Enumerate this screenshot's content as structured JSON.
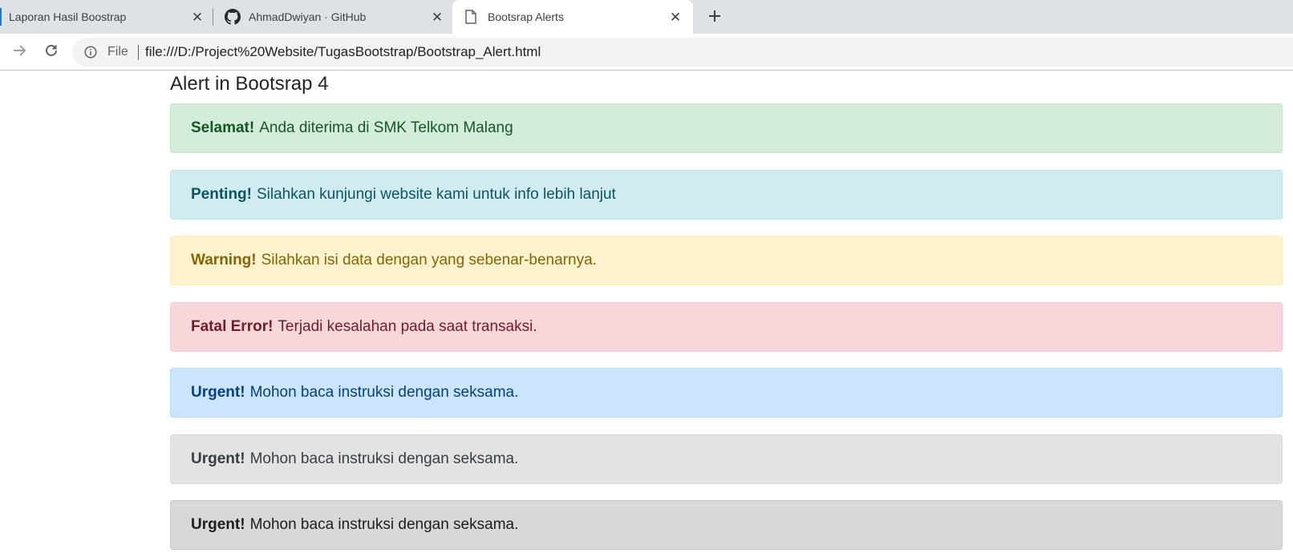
{
  "tabs": [
    {
      "label": "Laporan Hasil Boostrap",
      "icon": "tab-edge-icon"
    },
    {
      "label": "AhmadDwiyan · GitHub",
      "icon": "github-icon"
    },
    {
      "label": "Bootsrap Alerts",
      "icon": "document-icon",
      "active": true
    }
  ],
  "toolbar": {
    "scheme_label": "File",
    "url": "file:///D:/Project%20Website/TugasBootstrap/Bootstrap_Alert.html"
  },
  "page": {
    "title": "Alert in Bootsrap 4",
    "alerts": [
      {
        "type": "success",
        "strong": "Selamat!",
        "text": "Anda diterima di SMK Telkom Malang"
      },
      {
        "type": "info",
        "strong": "Penting!",
        "text": "Silahkan kunjungi website kami untuk info lebih lanjut"
      },
      {
        "type": "warning",
        "strong": "Warning!",
        "text": "Silahkan isi data dengan yang sebenar-benarnya."
      },
      {
        "type": "danger",
        "strong": "Fatal Error!",
        "text": "Terjadi kesalahan pada saat transaksi."
      },
      {
        "type": "primary",
        "strong": "Urgent!",
        "text": "Mohon baca instruksi dengan seksama."
      },
      {
        "type": "secondary",
        "strong": "Urgent!",
        "text": "Mohon baca instruksi dengan seksama."
      },
      {
        "type": "dark",
        "strong": "Urgent!",
        "text": "Mohon baca instruksi dengan seksama."
      }
    ]
  },
  "colors": {
    "tabstrip_bg": "#dee1e6",
    "omnibox_bg": "#f1f3f4",
    "success_bg": "#d4edda",
    "info_bg": "#d1ecf1",
    "warning_bg": "#fff3cd",
    "danger_bg": "#f8d7da",
    "primary_bg": "#cce5ff",
    "secondary_bg": "#e2e3e5",
    "dark_bg": "#d6d8d9"
  }
}
